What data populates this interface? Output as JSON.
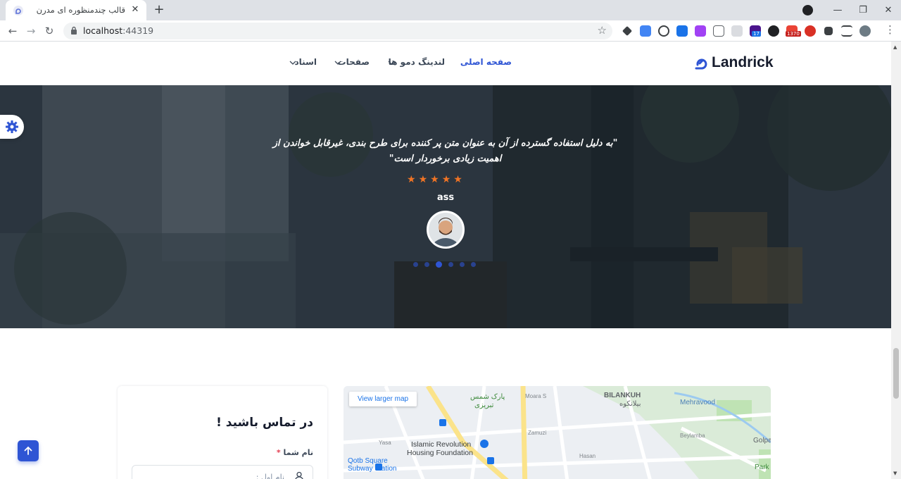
{
  "browser": {
    "tab_title": "قالب چندمنظوره ای مدرن",
    "url_host": "localhost",
    "url_port": ":44319",
    "extension_badges": [
      "17",
      "1370"
    ]
  },
  "site": {
    "logo_text": "Landrick",
    "nav": [
      {
        "label": "صفحه اصلی"
      },
      {
        "label": "لندینگ دمو ها"
      },
      {
        "label": "صفحات"
      },
      {
        "label": "اسناد"
      }
    ]
  },
  "testimonial": {
    "quote": "\"به دلیل استفاده گسترده از آن به عنوان متن پر کننده برای طرح بندی، غیرقابل خواندن از اهمیت زیادی برخوردار است\"",
    "stars": 5,
    "author": "ass",
    "slides": 6,
    "active_slide": 3
  },
  "contact": {
    "title": "در تماس باشید !",
    "name_label": "نام شما",
    "required_mark": "*",
    "name_placeholder": "نام اول :"
  },
  "map": {
    "larger_map": "View larger map",
    "labels": {
      "park_fa": "پارک شمس",
      "park_fa2": "تبریزی",
      "bilankuh": "BILANKUH",
      "bilankuh_fa": "بیلانکوه",
      "mehravood": "Mehravood",
      "islamic1": "Islamic Revolution",
      "islamic2": "Housing Foundation",
      "qotb1": "Qotb Square",
      "qotb2": "Subway Station",
      "golpa": "Golpa",
      "park_r": "Park",
      "hasan": "Hasan",
      "zamuzi": "Zamuzi",
      "beylamba": "Beylamba",
      "yasa": "Yasa",
      "moara": "Moara S"
    }
  },
  "colors": {
    "primary": "#2f55d4",
    "star": "#f17425",
    "heading": "#161c2d"
  }
}
